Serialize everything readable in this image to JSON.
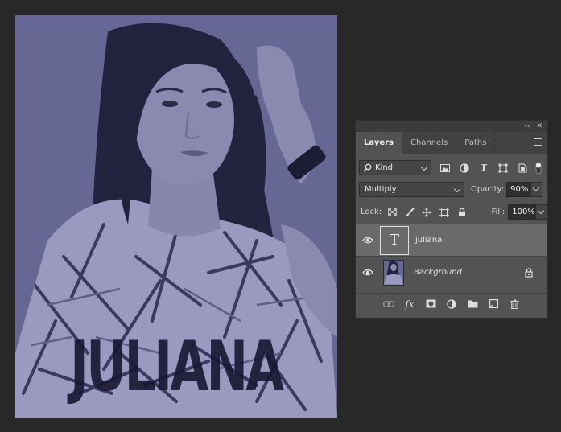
{
  "artwork": {
    "text": "JULIANA",
    "tint_color": "#676793",
    "text_color": "#171733"
  },
  "panel": {
    "collapse_glyph": "‹‹",
    "close_glyph": "✕",
    "tabs": [
      {
        "label": "Layers",
        "active": true
      },
      {
        "label": "Channels",
        "active": false
      },
      {
        "label": "Paths",
        "active": false
      }
    ],
    "filter": {
      "kind_label": "Kind",
      "icons": [
        "image-filter-icon",
        "adjustment-filter-icon",
        "type-filter-icon",
        "shape-filter-icon",
        "smart-object-filter-icon"
      ],
      "type_glyph": "T"
    },
    "blend": {
      "mode": "Multiply",
      "opacity_label": "Opacity:",
      "opacity_value": "90%"
    },
    "lock": {
      "label": "Lock:",
      "fill_label": "Fill:",
      "fill_value": "100%"
    },
    "layers": [
      {
        "name": "juliana",
        "type": "text",
        "selected": true,
        "thumb_glyph": "T"
      },
      {
        "name": "Background",
        "type": "image",
        "selected": false,
        "locked": true
      }
    ],
    "bottom_icons": [
      "link-layers-icon",
      "fx-icon",
      "add-mask-icon",
      "new-adjustment-icon",
      "new-group-icon",
      "new-layer-icon",
      "delete-layer-icon"
    ],
    "fx_label": "fx"
  }
}
